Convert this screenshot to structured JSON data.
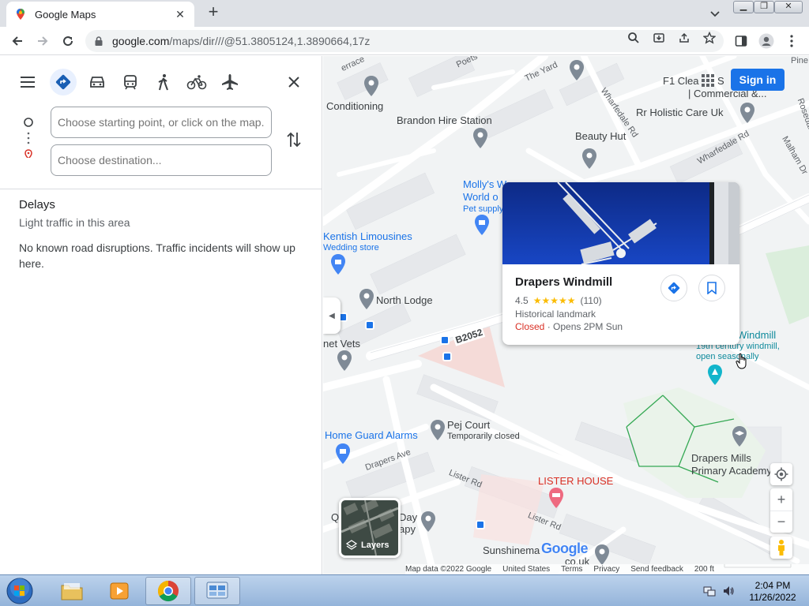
{
  "browser": {
    "tab_title": "Google Maps",
    "url_host": "google.com",
    "url_path": "/maps/dir///@51.3805124,1.3890664,17z"
  },
  "panel": {
    "start_placeholder": "Choose starting point, or click on the map...",
    "dest_placeholder": "Choose destination...",
    "delays_title": "Delays",
    "delays_sub": "Light traffic in this area",
    "delays_msg": "No known road disruptions. Traffic incidents will show up here."
  },
  "map": {
    "signin_label": "Sign in",
    "labels": {
      "conditioning": "Conditioning",
      "brandon": "Brandon Hire Station",
      "beauty": "Beauty Hut",
      "f1": "F1 Clea",
      "f1b": "S",
      "commercial": "| Commercial &...",
      "rr": "Rr Holistic Care Uk",
      "molly1": "Molly's W",
      "molly2": "World o",
      "pet": "Pet supply",
      "kentish": "Kentish Limousines",
      "wedding": "Wedding store",
      "north": "North Lodge",
      "netvets": "net Vets",
      "b2052": "B2052",
      "windmill": "Windmill",
      "windmill_sub1": "19th century windmill,",
      "windmill_sub2": "open seasonally",
      "pej": "Pej Court",
      "pej_sub": "Temporarily closed",
      "homeguard": "Home Guard Alarms",
      "drapersmills1": "Drapers Mills",
      "drapersmills2": "Primary Academy",
      "lister": "LISTER HOUSE",
      "q": "Q",
      "day": "Day",
      "apy": "apy",
      "sunshine": "Sunshinema",
      "couk": "co.uk",
      "terrace": "errace",
      "poets": "Poets",
      "yard": "The Yard",
      "wharfedale1": "Wharfedale Rd",
      "wharfedale2": "Wharfedale Rd",
      "malham": "Malham Dr",
      "rosedale": "Rosedale",
      "pine": "Pine",
      "drapersave": "Drapers Ave",
      "listerrd1": "Lister Rd",
      "listerrd2": "Lister Rd"
    },
    "card": {
      "name": "Drapers Windmill",
      "rating": "4.5",
      "stars": "★★★★★",
      "count": "(110)",
      "type": "Historical landmark",
      "closed": "Closed",
      "opens": " · Opens 2PM Sun"
    },
    "layers_label": "Layers",
    "logo": "Google",
    "footer": {
      "data": "Map data ©2022 Google",
      "country": "United States",
      "terms": "Terms",
      "privacy": "Privacy",
      "feedback": "Send feedback",
      "scale": "200 ft"
    }
  },
  "taskbar": {
    "time": "2:04 PM",
    "date": "11/26/2022"
  },
  "colors": {
    "accent": "#1a73e8",
    "closed": "#d93025",
    "star": "#fbbc04"
  }
}
